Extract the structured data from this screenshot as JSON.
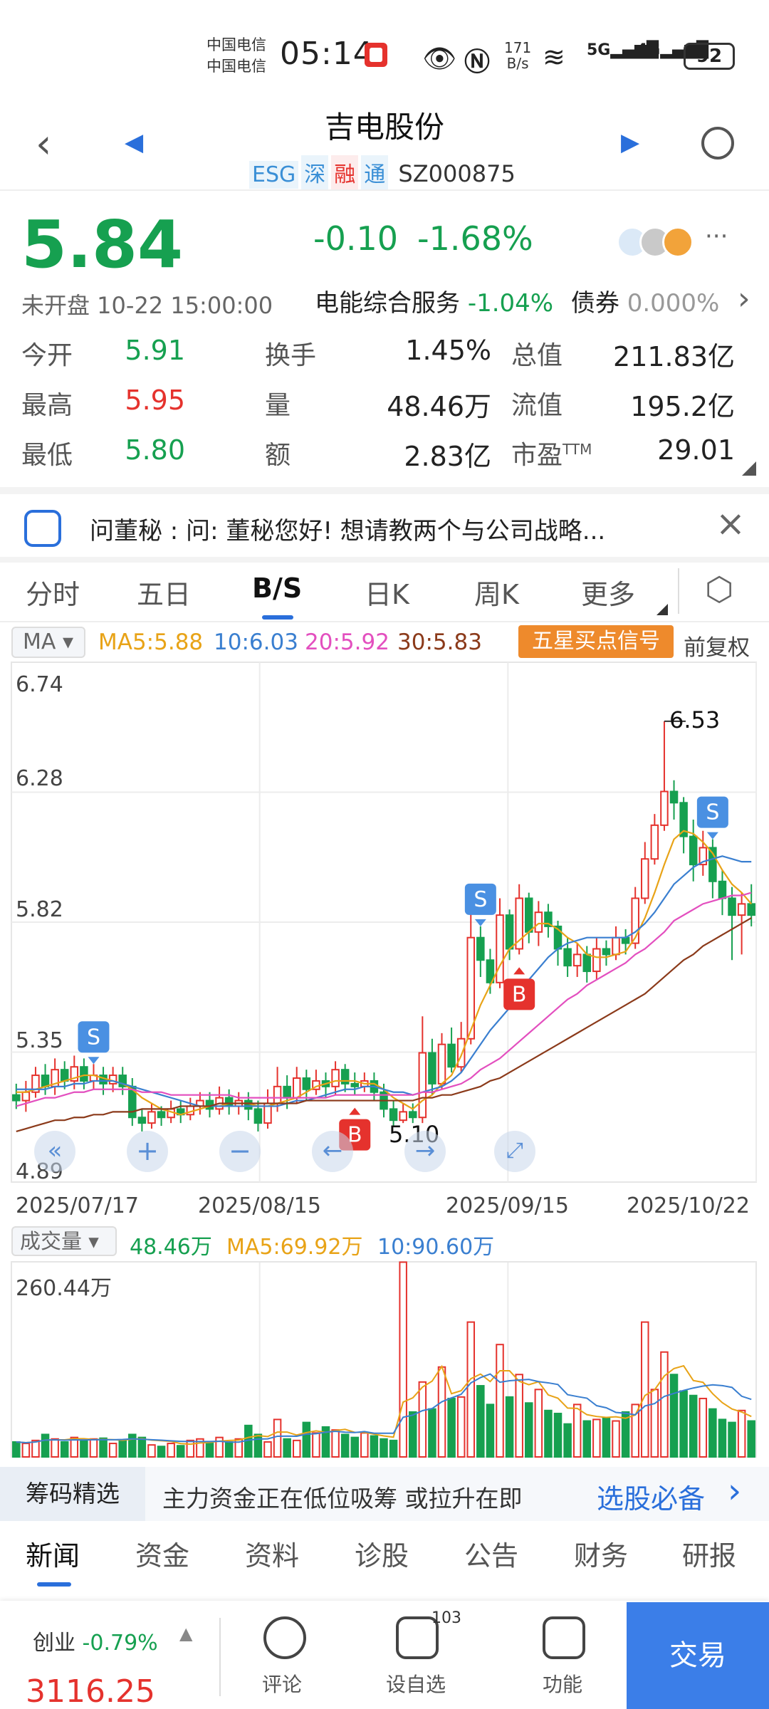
{
  "status_bar": {
    "carrier1": "中国电信",
    "carrier2": "中国电信",
    "time": "05:14",
    "net_speed_num": "171",
    "net_speed_unit": "B/s",
    "battery": "92"
  },
  "header": {
    "title": "吉电股份",
    "tags": [
      "ESG",
      "深",
      "融",
      "通"
    ],
    "code": "SZ000875"
  },
  "quote": {
    "price": "5.84",
    "change": "-0.10",
    "change_pct": "-1.68%",
    "status": "未开盘 10-22 15:00:00",
    "sector": "电能综合服务",
    "sector_pct": "-1.04%",
    "bond_label": "债券",
    "bond_pct": "0.000%",
    "grid": [
      {
        "k": "今开",
        "v": "5.91",
        "c": "green"
      },
      {
        "k": "换手",
        "v": "1.45%",
        "c": "black"
      },
      {
        "k": "总值",
        "v": "211.83亿",
        "c": "black"
      },
      {
        "k": "最高",
        "v": "5.95",
        "c": "red"
      },
      {
        "k": "量",
        "v": "48.46万",
        "c": "black"
      },
      {
        "k": "流值",
        "v": "195.2亿",
        "c": "black"
      },
      {
        "k": "最低",
        "v": "5.80",
        "c": "green"
      },
      {
        "k": "额",
        "v": "2.83亿",
        "c": "black"
      },
      {
        "k": "市盈TTM",
        "v": "29.01",
        "c": "black"
      }
    ]
  },
  "notice": {
    "text": "问董秘 : 问:  董秘您好!  想请教两个与公司战略..."
  },
  "chart_tabs": [
    "分时",
    "五日",
    "B/S",
    "日K",
    "周K",
    "更多"
  ],
  "ma_bar": {
    "selector": "MA",
    "ma5": "MA5:5.88",
    "ma10": "10:6.03",
    "ma20": "20:5.92",
    "ma30": "30:5.83",
    "signal_btn": "五星买点信号",
    "adjust": "前复权"
  },
  "kline": {
    "y_labels": [
      "6.74",
      "6.28",
      "5.82",
      "5.35",
      "4.89"
    ],
    "x_labels": [
      "2025/07/17",
      "2025/08/15",
      "2025/09/15",
      "2025/10/22"
    ],
    "high_label": "6.53",
    "low_label": "5.10",
    "markers": [
      "S",
      "B",
      "S",
      "B",
      "S"
    ]
  },
  "volume_bar": {
    "selector": "成交量",
    "vol": "48.46万",
    "ma5": "MA5:69.92万",
    "ma10": "10:90.60万",
    "max_label": "260.44万"
  },
  "chip_bar": {
    "label": "筹码精选",
    "text": "主力资金正在低位吸筹 或拉升在即",
    "link": "选股必备"
  },
  "bottom_tabs": [
    "新闻",
    "资金",
    "资料",
    "诊股",
    "公告",
    "财务",
    "研报"
  ],
  "footer": {
    "index_name": "创业",
    "index_pct": "-0.79%",
    "index_value": "3116.25",
    "comment_label": "评论",
    "watch_label": "设自选",
    "watch_badge": "103",
    "func_label": "功能",
    "trade_label": "交易"
  },
  "chart_data": {
    "type": "candlestick",
    "ylim": [
      4.89,
      6.74
    ],
    "x_ticks": [
      "2025/07/17",
      "2025/08/15",
      "2025/09/15",
      "2025/10/22"
    ],
    "annotations": {
      "high": 6.53,
      "low": 5.1
    },
    "candles": [
      [
        5.2,
        5.18,
        5.24,
        5.15
      ],
      [
        5.18,
        5.21,
        5.25,
        5.14
      ],
      [
        5.21,
        5.27,
        5.3,
        5.19
      ],
      [
        5.27,
        5.23,
        5.31,
        5.2
      ],
      [
        5.23,
        5.29,
        5.33,
        5.2
      ],
      [
        5.29,
        5.25,
        5.32,
        5.22
      ],
      [
        5.25,
        5.3,
        5.34,
        5.22
      ],
      [
        5.3,
        5.25,
        5.33,
        5.22
      ],
      [
        5.25,
        5.27,
        5.31,
        5.22
      ],
      [
        5.27,
        5.24,
        5.3,
        5.2
      ],
      [
        5.24,
        5.27,
        5.3,
        5.21
      ],
      [
        5.27,
        5.23,
        5.3,
        5.2
      ],
      [
        5.23,
        5.12,
        5.26,
        5.09
      ],
      [
        5.12,
        5.1,
        5.15,
        5.07
      ],
      [
        5.1,
        5.14,
        5.17,
        5.08
      ],
      [
        5.14,
        5.12,
        5.16,
        5.09
      ],
      [
        5.12,
        5.15,
        5.18,
        5.1
      ],
      [
        5.15,
        5.13,
        5.18,
        5.1
      ],
      [
        5.13,
        5.16,
        5.19,
        5.11
      ],
      [
        5.16,
        5.18,
        5.21,
        5.13
      ],
      [
        5.18,
        5.15,
        5.21,
        5.12
      ],
      [
        5.15,
        5.19,
        5.23,
        5.13
      ],
      [
        5.19,
        5.16,
        5.22,
        5.13
      ],
      [
        5.16,
        5.18,
        5.21,
        5.13
      ],
      [
        5.18,
        5.15,
        5.21,
        5.11
      ],
      [
        5.15,
        5.1,
        5.18,
        5.07
      ],
      [
        5.1,
        5.17,
        5.22,
        5.08
      ],
      [
        5.17,
        5.23,
        5.3,
        5.14
      ],
      [
        5.23,
        5.19,
        5.27,
        5.15
      ],
      [
        5.19,
        5.26,
        5.3,
        5.17
      ],
      [
        5.26,
        5.22,
        5.29,
        5.18
      ],
      [
        5.22,
        5.25,
        5.29,
        5.2
      ],
      [
        5.25,
        5.23,
        5.28,
        5.19
      ],
      [
        5.23,
        5.29,
        5.32,
        5.2
      ],
      [
        5.29,
        5.24,
        5.31,
        5.21
      ],
      [
        5.24,
        5.23,
        5.28,
        5.2
      ],
      [
        5.23,
        5.25,
        5.28,
        5.21
      ],
      [
        5.25,
        5.21,
        5.28,
        5.18
      ],
      [
        5.21,
        5.15,
        5.24,
        5.12
      ],
      [
        5.15,
        5.11,
        5.18,
        5.09
      ],
      [
        5.11,
        5.14,
        5.17,
        5.1
      ],
      [
        5.14,
        5.12,
        5.17,
        5.1
      ],
      [
        5.12,
        5.35,
        5.48,
        5.1
      ],
      [
        5.35,
        5.24,
        5.4,
        5.2
      ],
      [
        5.24,
        5.38,
        5.42,
        5.22
      ],
      [
        5.38,
        5.3,
        5.44,
        5.28
      ],
      [
        5.3,
        5.4,
        5.46,
        5.28
      ],
      [
        5.4,
        5.76,
        5.88,
        5.38
      ],
      [
        5.76,
        5.68,
        5.8,
        5.62
      ],
      [
        5.68,
        5.6,
        5.72,
        5.56
      ],
      [
        5.6,
        5.84,
        5.9,
        5.58
      ],
      [
        5.84,
        5.72,
        5.86,
        5.68
      ],
      [
        5.72,
        5.9,
        5.95,
        5.7
      ],
      [
        5.9,
        5.78,
        5.92,
        5.74
      ],
      [
        5.78,
        5.85,
        5.89,
        5.73
      ],
      [
        5.85,
        5.8,
        5.88,
        5.76
      ],
      [
        5.8,
        5.72,
        5.82,
        5.66
      ],
      [
        5.72,
        5.66,
        5.76,
        5.62
      ],
      [
        5.66,
        5.7,
        5.74,
        5.62
      ],
      [
        5.7,
        5.64,
        5.73,
        5.6
      ],
      [
        5.64,
        5.72,
        5.76,
        5.61
      ],
      [
        5.72,
        5.7,
        5.75,
        5.66
      ],
      [
        5.7,
        5.76,
        5.8,
        5.68
      ],
      [
        5.76,
        5.74,
        5.79,
        5.7
      ],
      [
        5.74,
        5.9,
        5.94,
        5.72
      ],
      [
        5.9,
        6.04,
        6.1,
        5.88
      ],
      [
        6.04,
        6.16,
        6.2,
        6.02
      ],
      [
        6.16,
        6.28,
        6.53,
        6.14
      ],
      [
        6.28,
        6.24,
        6.32,
        6.18
      ],
      [
        6.24,
        6.12,
        6.26,
        6.06
      ],
      [
        6.12,
        6.02,
        6.18,
        5.96
      ],
      [
        6.02,
        6.08,
        6.14,
        5.98
      ],
      [
        6.08,
        5.96,
        6.11,
        5.9
      ],
      [
        5.96,
        5.9,
        6.0,
        5.84
      ],
      [
        5.9,
        5.84,
        5.94,
        5.68
      ],
      [
        5.84,
        5.88,
        5.92,
        5.7
      ],
      [
        5.88,
        5.84,
        5.95,
        5.8
      ]
    ],
    "ma5": [
      5.21,
      5.21,
      5.22,
      5.23,
      5.24,
      5.25,
      5.26,
      5.27,
      5.27,
      5.26,
      5.25,
      5.24,
      5.22,
      5.19,
      5.17,
      5.15,
      5.14,
      5.13,
      5.14,
      5.15,
      5.16,
      5.16,
      5.17,
      5.17,
      5.17,
      5.16,
      5.16,
      5.17,
      5.18,
      5.19,
      5.21,
      5.23,
      5.24,
      5.25,
      5.25,
      5.25,
      5.24,
      5.24,
      5.22,
      5.19,
      5.17,
      5.15,
      5.18,
      5.2,
      5.24,
      5.27,
      5.34,
      5.43,
      5.52,
      5.59,
      5.66,
      5.72,
      5.75,
      5.78,
      5.81,
      5.81,
      5.79,
      5.76,
      5.74,
      5.7,
      5.69,
      5.69,
      5.7,
      5.71,
      5.76,
      5.83,
      5.92,
      6.02,
      6.11,
      6.14,
      6.13,
      6.1,
      6.06,
      6.0,
      5.95,
      5.92,
      5.88
    ],
    "ma10": [
      5.22,
      5.22,
      5.22,
      5.22,
      5.23,
      5.23,
      5.24,
      5.24,
      5.25,
      5.25,
      5.25,
      5.24,
      5.23,
      5.22,
      5.21,
      5.2,
      5.19,
      5.18,
      5.17,
      5.16,
      5.16,
      5.16,
      5.16,
      5.16,
      5.16,
      5.16,
      5.16,
      5.16,
      5.17,
      5.18,
      5.18,
      5.19,
      5.2,
      5.21,
      5.22,
      5.22,
      5.23,
      5.23,
      5.22,
      5.21,
      5.21,
      5.2,
      5.21,
      5.22,
      5.23,
      5.25,
      5.28,
      5.33,
      5.38,
      5.43,
      5.47,
      5.51,
      5.56,
      5.61,
      5.65,
      5.69,
      5.72,
      5.74,
      5.75,
      5.76,
      5.76,
      5.76,
      5.76,
      5.76,
      5.78,
      5.81,
      5.85,
      5.9,
      5.95,
      5.98,
      6.01,
      6.03,
      6.04,
      6.05,
      6.04,
      6.03,
      6.03
    ],
    "ma20": [
      5.16,
      5.17,
      5.18,
      5.19,
      5.19,
      5.2,
      5.21,
      5.21,
      5.22,
      5.22,
      5.22,
      5.22,
      5.22,
      5.21,
      5.21,
      5.21,
      5.2,
      5.2,
      5.2,
      5.2,
      5.2,
      5.2,
      5.2,
      5.19,
      5.19,
      5.19,
      5.19,
      5.19,
      5.19,
      5.19,
      5.19,
      5.19,
      5.19,
      5.2,
      5.2,
      5.2,
      5.2,
      5.2,
      5.2,
      5.2,
      5.2,
      5.2,
      5.21,
      5.21,
      5.22,
      5.23,
      5.24,
      5.26,
      5.29,
      5.31,
      5.33,
      5.36,
      5.39,
      5.42,
      5.45,
      5.48,
      5.51,
      5.54,
      5.56,
      5.59,
      5.61,
      5.63,
      5.65,
      5.67,
      5.7,
      5.72,
      5.75,
      5.78,
      5.82,
      5.84,
      5.86,
      5.88,
      5.89,
      5.9,
      5.91,
      5.91,
      5.92
    ],
    "ma30": [
      5.07,
      5.08,
      5.09,
      5.1,
      5.11,
      5.11,
      5.12,
      5.12,
      5.13,
      5.13,
      5.14,
      5.14,
      5.14,
      5.15,
      5.15,
      5.15,
      5.15,
      5.16,
      5.16,
      5.16,
      5.16,
      5.17,
      5.17,
      5.17,
      5.17,
      5.17,
      5.17,
      5.17,
      5.17,
      5.17,
      5.18,
      5.18,
      5.18,
      5.18,
      5.18,
      5.18,
      5.18,
      5.18,
      5.18,
      5.18,
      5.18,
      5.18,
      5.19,
      5.19,
      5.2,
      5.2,
      5.21,
      5.22,
      5.23,
      5.25,
      5.26,
      5.28,
      5.3,
      5.32,
      5.34,
      5.36,
      5.38,
      5.4,
      5.42,
      5.44,
      5.46,
      5.48,
      5.5,
      5.52,
      5.54,
      5.56,
      5.59,
      5.62,
      5.65,
      5.68,
      5.7,
      5.73,
      5.75,
      5.77,
      5.79,
      5.81,
      5.83
    ],
    "volume": [
      20,
      18,
      22,
      30,
      24,
      20,
      26,
      22,
      24,
      25,
      18,
      22,
      30,
      26,
      16,
      14,
      18,
      15,
      22,
      24,
      18,
      26,
      20,
      24,
      42,
      30,
      20,
      50,
      24,
      22,
      46,
      32,
      40,
      36,
      30,
      26,
      32,
      28,
      24,
      22,
      260,
      60,
      100,
      64,
      120,
      78,
      80,
      180,
      95,
      70,
      150,
      80,
      110,
      72,
      90,
      62,
      58,
      44,
      70,
      48,
      50,
      52,
      48,
      60,
      70,
      180,
      90,
      140,
      110,
      88,
      82,
      78,
      64,
      50,
      46,
      62,
      48
    ],
    "volume_ylim": [
      0,
      260.44
    ]
  }
}
